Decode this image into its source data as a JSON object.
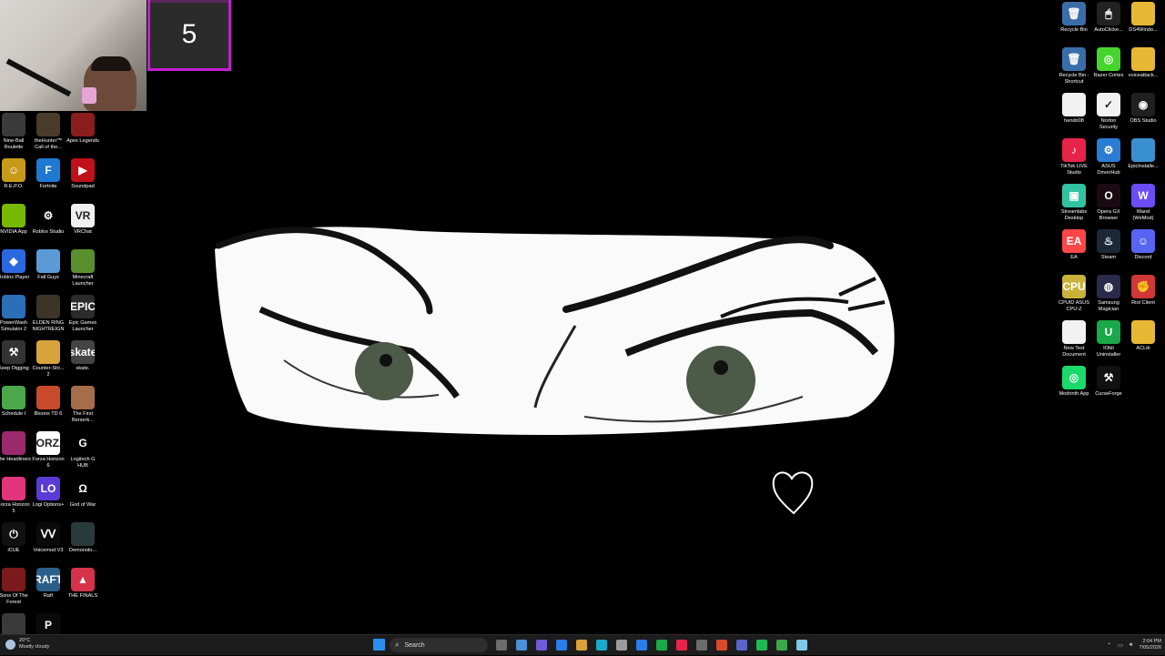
{
  "overlay": {
    "counter_value": "5"
  },
  "left_icons": [
    {
      "label": "Nine-Ball Roulette",
      "color": "#3a3a3a",
      "glyph": ""
    },
    {
      "label": "theHunter™ Call of the...",
      "color": "#4a3b2a",
      "glyph": ""
    },
    {
      "label": "Apex Legends",
      "color": "#8a1d1d",
      "glyph": ""
    },
    {
      "label": "R.E.P.O.",
      "color": "#c79a1a",
      "glyph": "☺"
    },
    {
      "label": "Fortnite",
      "color": "#1f78d1",
      "glyph": "F"
    },
    {
      "label": "Soundpad",
      "color": "#c0111a",
      "glyph": "▶"
    },
    {
      "label": "NVIDIA App",
      "color": "#76b900",
      "glyph": ""
    },
    {
      "label": "Roblox Studio",
      "color": "#000000",
      "glyph": "⚙"
    },
    {
      "label": "VRChat",
      "color": "#f0f0f0",
      "glyph": "VR"
    },
    {
      "label": "Roblox Player",
      "color": "#2a68e0",
      "glyph": "◆"
    },
    {
      "label": "Fall Guys",
      "color": "#5a9ad6",
      "glyph": ""
    },
    {
      "label": "Minecraft Launcher",
      "color": "#5a8f2e",
      "glyph": ""
    },
    {
      "label": "PowerWash Simulator 2",
      "color": "#2a6fb8",
      "glyph": ""
    },
    {
      "label": "ELDEN RING NIGHTREIGN",
      "color": "#3d3428",
      "glyph": ""
    },
    {
      "label": "Epic Games Launcher",
      "color": "#2b2b2b",
      "glyph": "EPIC"
    },
    {
      "label": "Keep Digging",
      "color": "#333333",
      "glyph": "⚒"
    },
    {
      "label": "Counter-Stri... 2",
      "color": "#d7a33a",
      "glyph": ""
    },
    {
      "label": "skate.",
      "color": "#444444",
      "glyph": "skate"
    },
    {
      "label": "Schedule I",
      "color": "#4aa84a",
      "glyph": ""
    },
    {
      "label": "Bloons TD 6",
      "color": "#c74a2a",
      "glyph": ""
    },
    {
      "label": "The First Berserk...",
      "color": "#a56d4a",
      "glyph": ""
    },
    {
      "label": "The Headliners",
      "color": "#9b2a6d",
      "glyph": ""
    },
    {
      "label": "Forza Horizon 6",
      "color": "#ffffff",
      "glyph": "FORZA"
    },
    {
      "label": "Logitech G HUB",
      "color": "#000000",
      "glyph": "G"
    },
    {
      "label": "Forza Horizon 5",
      "color": "#e0357d",
      "glyph": ""
    },
    {
      "label": "Logi Options+",
      "color": "#5b3bd6",
      "glyph": "LO"
    },
    {
      "label": "God of War",
      "color": "#000000",
      "glyph": "Ω"
    },
    {
      "label": "iCUE",
      "color": "#111111",
      "glyph": "⏻"
    },
    {
      "label": "Voicemod V3",
      "color": "#0a0a0a",
      "glyph": "ᐯᐯ"
    },
    {
      "label": "Demonolo...",
      "color": "#2a3a3a",
      "glyph": ""
    },
    {
      "label": "Sons Of The Forest",
      "color": "#7a1a1a",
      "glyph": ""
    },
    {
      "label": "Raft",
      "color": "#2a5f8a",
      "glyph": "RAFT"
    },
    {
      "label": "THE FINALS",
      "color": "#d6334a",
      "glyph": "▲"
    },
    {
      "label": "Ready or Not",
      "color": "#3a3a3a",
      "glyph": ""
    },
    {
      "label": "Phasmoph...",
      "color": "#0a0a0a",
      "glyph": "P"
    }
  ],
  "right_icons": [
    {
      "label": "Recycle Bin",
      "color": "#3b6ea8",
      "glyph": "🗑"
    },
    {
      "label": "AutoClicke...",
      "color": "#222222",
      "glyph": "🖱"
    },
    {
      "label": "DS4Windo...",
      "color": "#e6b833",
      "glyph": ""
    },
    {
      "label": "Recycle Bin - Shortcut",
      "color": "#3b6ea8",
      "glyph": "🗑"
    },
    {
      "label": "Razer Cortex",
      "color": "#44d62c",
      "glyph": "◎"
    },
    {
      "label": "voiceattack...",
      "color": "#e6b833",
      "glyph": ""
    },
    {
      "label": "hendo08",
      "color": "#f2f2f2",
      "glyph": ""
    },
    {
      "label": "Norton Security",
      "color": "#f2f2f2",
      "glyph": "✓"
    },
    {
      "label": "OBS Studio",
      "color": "#202020",
      "glyph": "◉"
    },
    {
      "label": "TikTok LIVE Studio",
      "color": "#e8234a",
      "glyph": "♪"
    },
    {
      "label": "ASUS DriverHub",
      "color": "#2b7cd3",
      "glyph": "⚙"
    },
    {
      "label": "EpicInstalle...",
      "color": "#3a8fd0",
      "glyph": ""
    },
    {
      "label": "Streamlabs Desktop",
      "color": "#31c3a2",
      "glyph": "▣"
    },
    {
      "label": "Opera GX Browser",
      "color": "#1a0a12",
      "glyph": "O"
    },
    {
      "label": "Wand (WeMod)",
      "color": "#6c4cf5",
      "glyph": "W"
    },
    {
      "label": "EA",
      "color": "#ff4747",
      "glyph": "EA"
    },
    {
      "label": "Steam",
      "color": "#1b2838",
      "glyph": "♨"
    },
    {
      "label": "Discord",
      "color": "#5865f2",
      "glyph": "☺"
    },
    {
      "label": "CPUID ASUS CPU-Z",
      "color": "#c9b23a",
      "glyph": "CPU"
    },
    {
      "label": "Samsung Magician",
      "color": "#2a2a4a",
      "glyph": "◍"
    },
    {
      "label": "Riot Client",
      "color": "#d13639",
      "glyph": "✊"
    },
    {
      "label": "New Text Document",
      "color": "#f2f2f2",
      "glyph": ""
    },
    {
      "label": "IObit Uninstaller",
      "color": "#1aa84a",
      "glyph": "U"
    },
    {
      "label": "ACLib",
      "color": "#e6b833",
      "glyph": ""
    },
    {
      "label": "Modrinth App",
      "color": "#1bd96a",
      "glyph": "◎"
    },
    {
      "label": "CurseForge",
      "color": "#111111",
      "glyph": "⚒"
    }
  ],
  "taskbar": {
    "weather_temp": "20°C",
    "weather_desc": "Mostly cloudy",
    "search_placeholder": "Search",
    "clock_time": "2:04 PM",
    "clock_date": "7/05/2026",
    "pinned_colors": [
      "#6b6b6b",
      "#4a90d9",
      "#6e5bd6",
      "#2b7de9",
      "#d8a13a",
      "#1aa9c9",
      "#9b9b9b",
      "#2b7de9",
      "#1aa84a",
      "#e8234a",
      "#6b6b6b",
      "#d94a2a",
      "#5a64c9",
      "#1db954",
      "#3aa84a",
      "#7ec8ea"
    ]
  }
}
